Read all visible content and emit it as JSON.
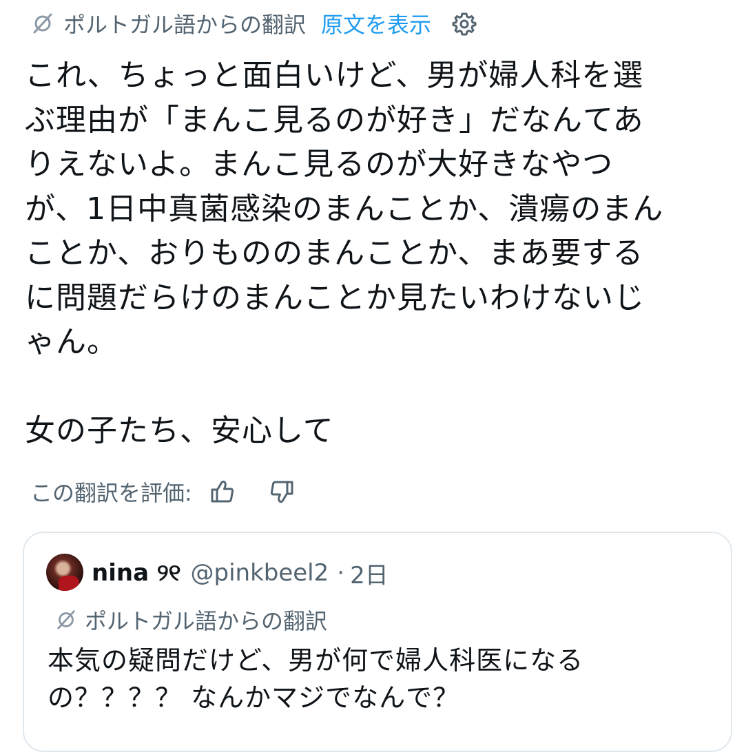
{
  "translation_bar": {
    "label": "ポルトガル語からの翻訳",
    "show_original": "原文を表示",
    "translate_icon": "translate-icon",
    "settings_icon": "gear-icon"
  },
  "tweet": {
    "lines": [
      "これ、ちょっと面白いけど、男が婦人科を選",
      "ぶ理由が「まんこ見るのが好き」だなんてあ",
      "りえないよ。まんこ見るのが大好きなやつ",
      "が、1日中真菌感染のまんことか、潰瘍のまん",
      "ことか、おりもののまんことか、まあ要する",
      "に問題だらけのまんことか見たいわけないじ",
      "ゃん。",
      "",
      "女の子たち、安心して"
    ]
  },
  "rating": {
    "label": "この翻訳を評価:",
    "thumbs_up_icon": "thumbs-up-icon",
    "thumbs_down_icon": "thumbs-down-icon"
  },
  "quote": {
    "avatar": "avatar",
    "name": "nina ୨୧",
    "handle": "@pinkbeel2",
    "separator": "·",
    "time": "2日",
    "translation_label": "ポルトガル語からの翻訳",
    "lines": [
      "本気の疑問だけど、男が何で婦人科医になる",
      "の？？？？ なんかマジでなんで？"
    ]
  },
  "colors": {
    "text": "#0f1419",
    "secondary": "#536471",
    "accent": "#1d9bf0",
    "border": "#e1e8ed"
  }
}
